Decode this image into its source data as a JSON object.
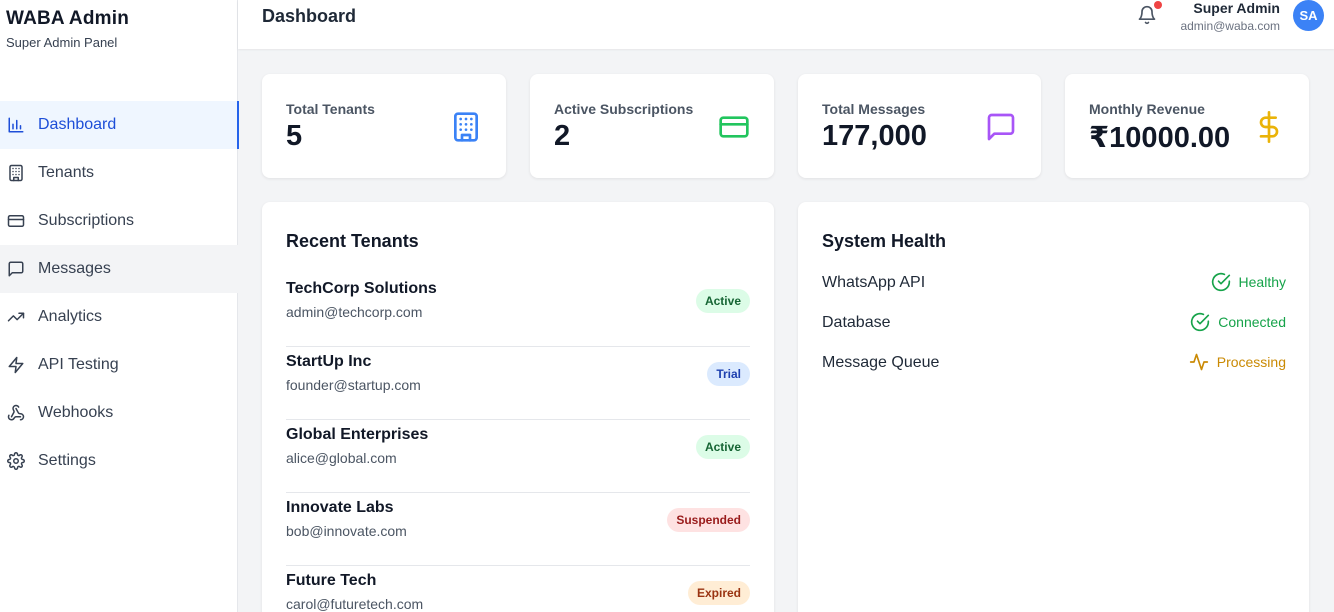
{
  "brand": {
    "title": "WABA Admin",
    "subtitle": "Super Admin Panel"
  },
  "sidebar": {
    "items": [
      {
        "label": "Dashboard",
        "icon": "bar-chart-icon"
      },
      {
        "label": "Tenants",
        "icon": "building-icon"
      },
      {
        "label": "Subscriptions",
        "icon": "credit-card-icon"
      },
      {
        "label": "Messages",
        "icon": "message-square-icon"
      },
      {
        "label": "Analytics",
        "icon": "trending-up-icon"
      },
      {
        "label": "API Testing",
        "icon": "zap-icon"
      },
      {
        "label": "Webhooks",
        "icon": "webhook-icon"
      },
      {
        "label": "Settings",
        "icon": "gear-icon"
      }
    ],
    "active": "Dashboard"
  },
  "header": {
    "title": "Dashboard",
    "user_name": "Super Admin",
    "user_email": "admin@waba.com",
    "avatar_initials": "SA",
    "notification_icon": "bell-icon"
  },
  "stats": [
    {
      "label": "Total Tenants",
      "value": "5",
      "icon": "building-icon",
      "color": "#3b82f6"
    },
    {
      "label": "Active Subscriptions",
      "value": "2",
      "icon": "credit-card-icon",
      "color": "#22c55e"
    },
    {
      "label": "Total Messages",
      "value": "177,000",
      "icon": "message-square-icon",
      "color": "#a855f7"
    },
    {
      "label": "Monthly Revenue",
      "value": "₹10000.00",
      "icon": "dollar-icon",
      "color": "#eab308"
    }
  ],
  "recent_tenants": {
    "title": "Recent Tenants",
    "rows": [
      {
        "name": "TechCorp Solutions",
        "email": "admin@techcorp.com",
        "status": "Active"
      },
      {
        "name": "StartUp Inc",
        "email": "founder@startup.com",
        "status": "Trial"
      },
      {
        "name": "Global Enterprises",
        "email": "alice@global.com",
        "status": "Active"
      },
      {
        "name": "Innovate Labs",
        "email": "bob@innovate.com",
        "status": "Suspended"
      },
      {
        "name": "Future Tech",
        "email": "carol@futuretech.com",
        "status": "Expired"
      }
    ]
  },
  "system_health": {
    "title": "System Health",
    "rows": [
      {
        "label": "WhatsApp API",
        "status": "Healthy",
        "icon": "check-circle-icon",
        "color": "#16a34a"
      },
      {
        "label": "Database",
        "status": "Connected",
        "icon": "check-circle-icon",
        "color": "#16a34a"
      },
      {
        "label": "Message Queue",
        "status": "Processing",
        "icon": "activity-icon",
        "color": "#ca8a04"
      }
    ]
  },
  "colors": {
    "accent": "#2563eb",
    "badge_active_bg": "#dcfce7",
    "badge_active_fg": "#166534",
    "badge_trial_bg": "#dbeafe",
    "badge_trial_fg": "#1e40af",
    "badge_suspended_bg": "#fee2e2",
    "badge_suspended_fg": "#991b1b",
    "badge_expired_bg": "#ffedd5",
    "badge_expired_fg": "#9a3412"
  }
}
